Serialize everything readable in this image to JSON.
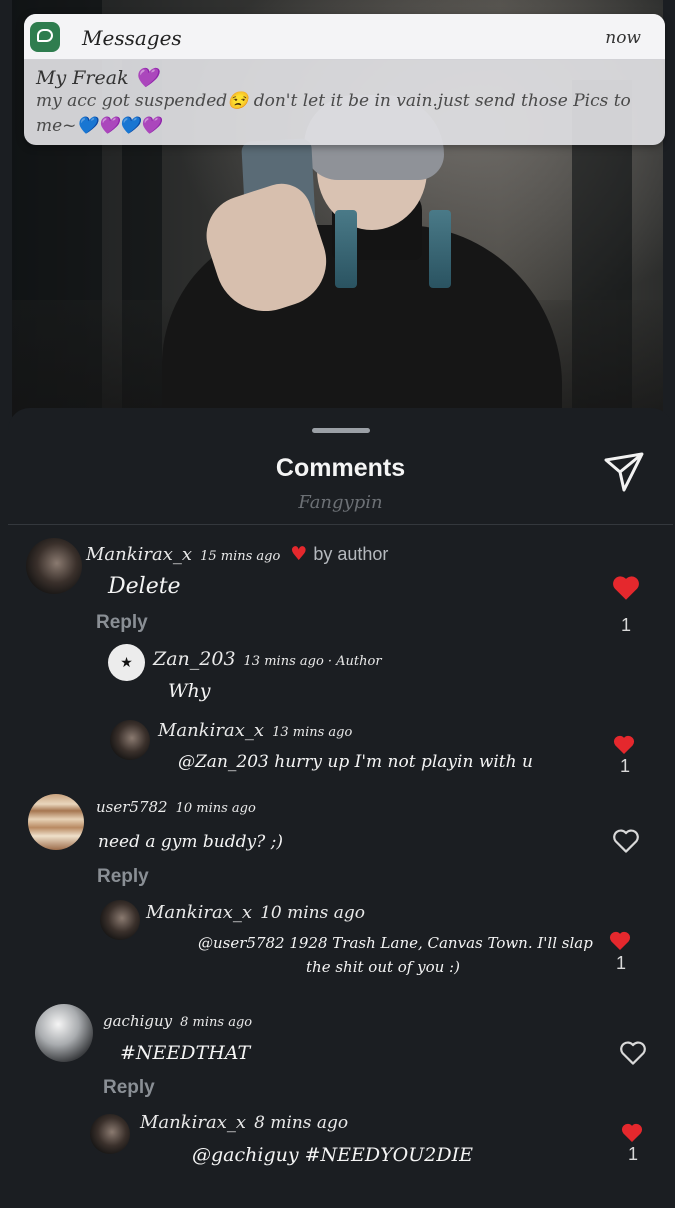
{
  "notification": {
    "app_name": "Messages",
    "time": "now",
    "sender": "My Freak 💜",
    "message": "my acc got suspended😒 don't let it be in vain.just send those Pics to me~💙💜💙💜"
  },
  "sheet": {
    "title": "Comments",
    "subtitle": "Fangypin"
  },
  "comments": [
    {
      "user": "Mankirax_x",
      "ago": "15 mins ago",
      "author_badge": "by author",
      "text": "Delete",
      "reply_label": "Reply",
      "likes": "1",
      "liked": true,
      "replies": [
        {
          "user": "Zan_203",
          "ago": "13 mins ago · Author",
          "text": "Why"
        },
        {
          "user": "Mankirax_x",
          "ago": "13 mins ago",
          "text": "@Zan_203 hurry up I'm not playin with u",
          "likes": "1",
          "liked": true
        }
      ]
    },
    {
      "user": "user5782",
      "ago": "10 mins ago",
      "text": "need a gym buddy? ;)",
      "reply_label": "Reply",
      "liked": false,
      "replies": [
        {
          "user": "Mankirax_x",
          "ago": "10 mins ago",
          "text_line1": "@user5782 1928 Trash Lane, Canvas Town. I'll slap",
          "text_line2": "the shit out of you :)",
          "likes": "1",
          "liked": true
        }
      ]
    },
    {
      "user": "gachiguy",
      "ago": "8 mins ago",
      "text": "#NEEDTHAT",
      "reply_label": "Reply",
      "liked": false,
      "replies": [
        {
          "user": "Mankirax_x",
          "ago": "8 mins ago",
          "text": "@gachiguy #NEEDYOU2DIE",
          "likes": "1",
          "liked": true
        }
      ]
    }
  ],
  "colors": {
    "heart_red": "#e5282d",
    "sheet_bg": "#1b1e22",
    "reply_grey": "#8a8f95"
  },
  "icons": [
    "send-icon",
    "heart-icon",
    "heart-outline-icon",
    "messages-app-icon"
  ]
}
